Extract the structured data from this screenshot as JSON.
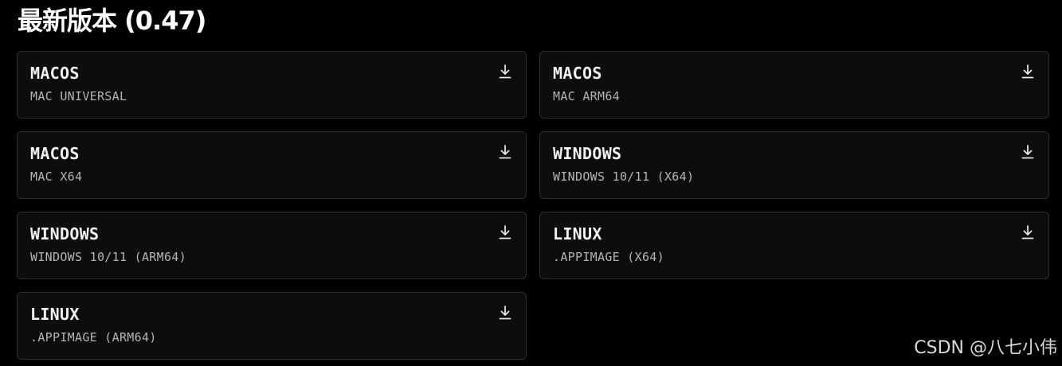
{
  "page": {
    "title": "最新版本 (0.47)"
  },
  "downloads": [
    {
      "os": "MACOS",
      "variant": "MAC UNIVERSAL",
      "icon": "download-icon"
    },
    {
      "os": "MACOS",
      "variant": "MAC ARM64",
      "icon": "download-icon"
    },
    {
      "os": "MACOS",
      "variant": "MAC X64",
      "icon": "download-icon"
    },
    {
      "os": "WINDOWS",
      "variant": "WINDOWS 10/11 (X64)",
      "icon": "download-icon"
    },
    {
      "os": "WINDOWS",
      "variant": "WINDOWS 10/11 (ARM64)",
      "icon": "download-icon"
    },
    {
      "os": "LINUX",
      "variant": ".APPIMAGE (X64)",
      "icon": "download-icon"
    },
    {
      "os": "LINUX",
      "variant": ".APPIMAGE (ARM64)",
      "icon": "download-icon"
    }
  ],
  "watermark": {
    "text": "CSDN @八七小伟"
  },
  "colors": {
    "background": "#000000",
    "card_background": "#0d0d0d",
    "card_border": "#2e2e2e",
    "primary_text": "#f2f2f2",
    "secondary_text": "#b4b4b4"
  }
}
